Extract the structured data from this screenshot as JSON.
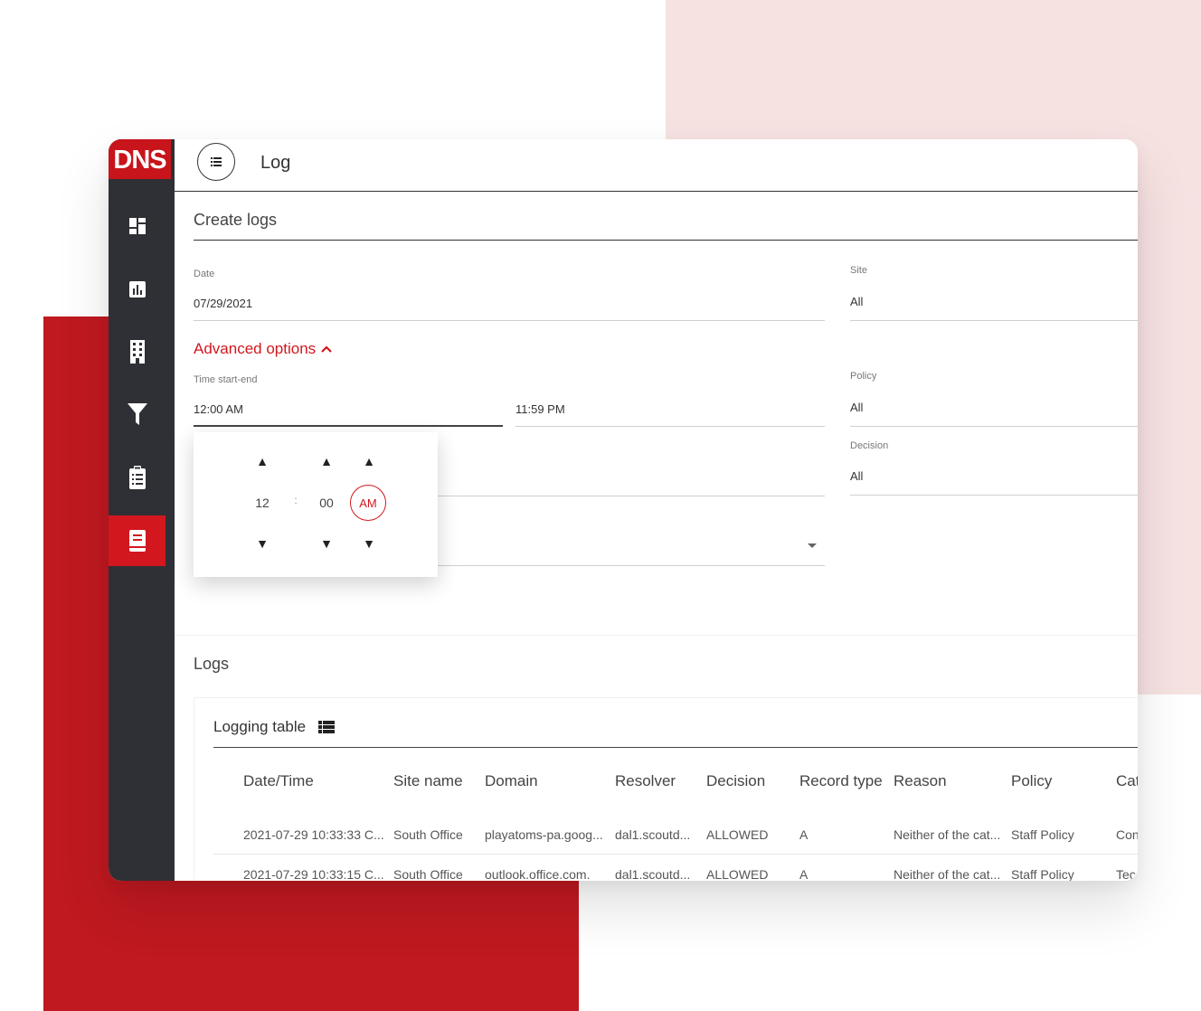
{
  "logo": {
    "text": "DNS"
  },
  "sidebar": {
    "items": [
      {
        "icon": "dashboard-icon"
      },
      {
        "icon": "chart-icon"
      },
      {
        "icon": "building-icon"
      },
      {
        "icon": "filter-icon"
      },
      {
        "icon": "clipboard-list-icon"
      },
      {
        "icon": "book-icon",
        "active": true
      }
    ]
  },
  "header": {
    "title": "Log"
  },
  "create": {
    "title": "Create logs",
    "date_label": "Date",
    "date_value": "07/29/2021",
    "site_label": "Site",
    "site_value": "All",
    "advanced_label": "Advanced options",
    "time_label": "Time start-end",
    "time_start": "12:00 AM",
    "time_end": "11:59 PM",
    "policy_label": "Policy",
    "policy_value": "All",
    "decision_label": "Decision",
    "decision_value": "All"
  },
  "time_picker": {
    "hour": "12",
    "separator": ":",
    "minute": "00",
    "period": "AM",
    "up_symbol": "▲",
    "down_symbol": "▼"
  },
  "logs": {
    "title": "Logs",
    "table_title": "Logging table",
    "columns": [
      "Date/Time",
      "Site name",
      "Domain",
      "Resolver",
      "Decision",
      "Record type",
      "Reason",
      "Policy",
      "Cat"
    ],
    "rows": [
      [
        "2021-07-29 10:33:33 C...",
        "South Office",
        "playatoms-pa.goog...",
        "dal1.scoutd...",
        "ALLOWED",
        "A",
        "Neither of the cat...",
        "Staff Policy",
        "Con"
      ],
      [
        "2021-07-29 10:33:15 C...",
        "South Office",
        "outlook.office.com.",
        "dal1.scoutd...",
        "ALLOWED",
        "A",
        "Neither of the cat...",
        "Staff Policy",
        "Tec"
      ]
    ]
  },
  "colors": {
    "accent": "#d2171e",
    "sidebar": "#2f3035",
    "pink_bg": "#f7e2e2",
    "red_bg": "#c01920"
  }
}
